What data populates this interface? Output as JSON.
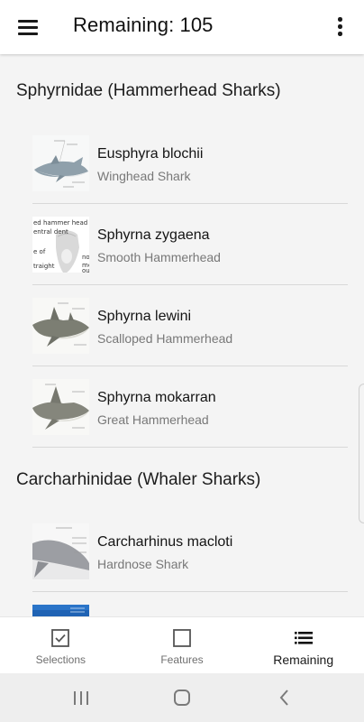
{
  "appbar": {
    "menu_icon": "hamburger-menu-icon",
    "title": "Remaining: 105",
    "overflow_icon": "more-vert-icon"
  },
  "sections": [
    {
      "title": "Sphyrnidae (Hammerhead Sharks)",
      "items": [
        {
          "scientific": "Eusphyra blochii",
          "common": "Winghead Shark"
        },
        {
          "scientific": "Sphyrna zygaena",
          "common": "Smooth Hammerhead"
        },
        {
          "scientific": "Sphyrna lewini",
          "common": "Scalloped Hammerhead"
        },
        {
          "scientific": "Sphyrna mokarran",
          "common": "Great Hammerhead"
        }
      ]
    },
    {
      "title": "Carcharhinidae (Whaler Sharks)",
      "items": [
        {
          "scientific": "Carcharhinus macloti",
          "common": "Hardnose Shark"
        },
        {
          "scientific": "",
          "common": ""
        }
      ]
    }
  ],
  "bottom_nav": [
    {
      "label": "Selections",
      "icon": "checkbox-checked-icon",
      "active": false
    },
    {
      "label": "Features",
      "icon": "checkbox-empty-icon",
      "active": false
    },
    {
      "label": "Remaining",
      "icon": "list-icon",
      "active": true
    }
  ],
  "system_nav": {
    "recents_icon": "recent-apps-icon",
    "home_icon": "home-icon",
    "back_icon": "back-icon"
  },
  "thumb_labels": {
    "zygaena": [
      "ed hammer head",
      "entral dent",
      "e of",
      "traight",
      "no",
      "mo",
      "ou"
    ]
  }
}
